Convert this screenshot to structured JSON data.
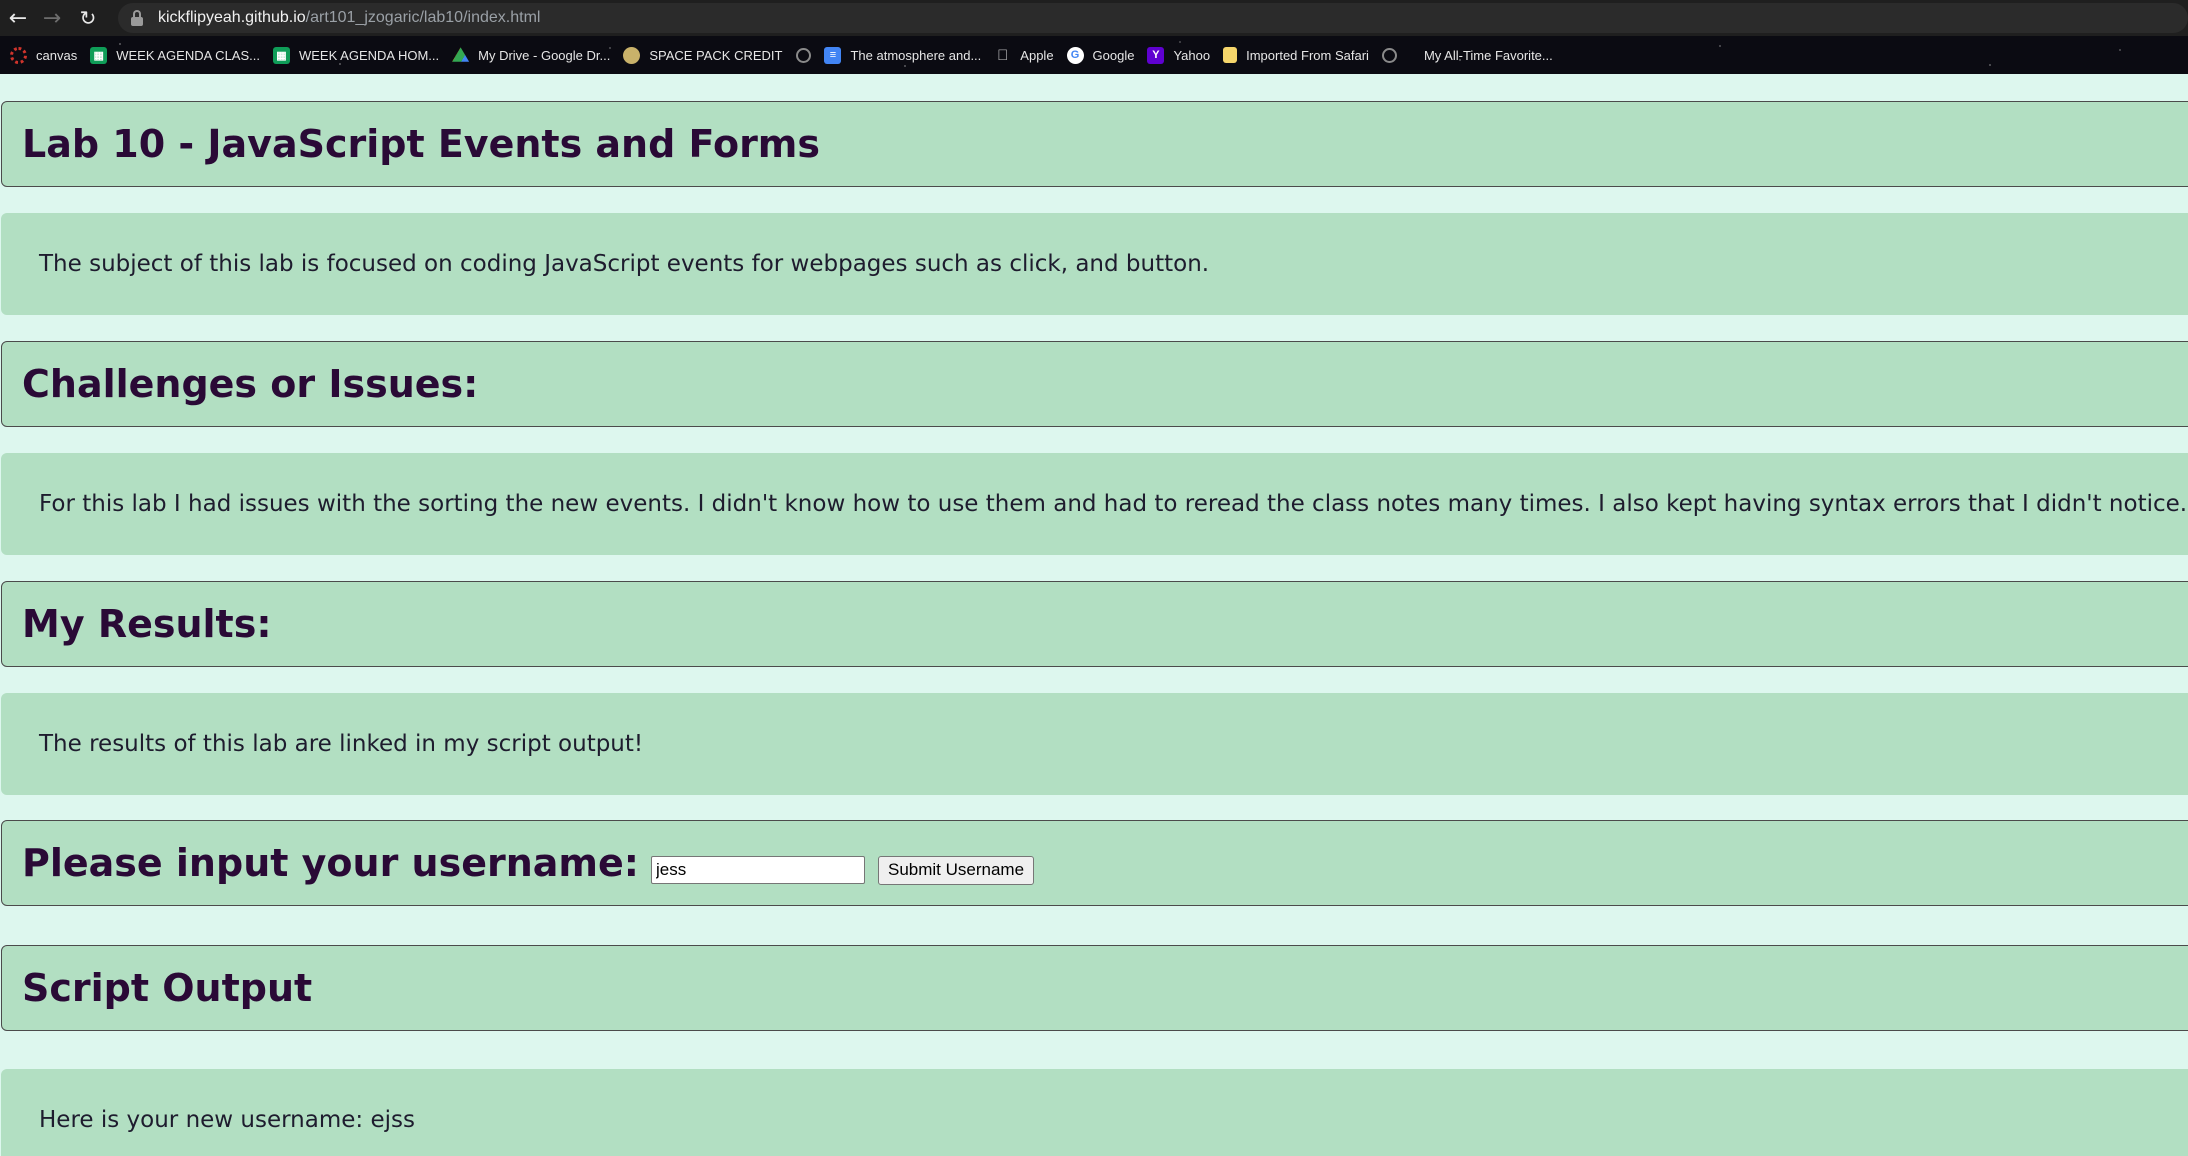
{
  "browser": {
    "url_host": "kickflipyeah.github.io",
    "url_path": "/art101_jzogaric/lab10/index.html",
    "bookmarks": [
      {
        "label": "canvas",
        "icon": "canvas-icon"
      },
      {
        "label": "WEEK AGENDA CLAS...",
        "icon": "sheets-icon"
      },
      {
        "label": "WEEK AGENDA HOM...",
        "icon": "sheets-icon"
      },
      {
        "label": "My Drive - Google Dr...",
        "icon": "drive-icon"
      },
      {
        "label": "SPACE PACK CREDIT",
        "icon": "space-pack-icon"
      },
      {
        "label": "The atmosphere and...",
        "icon": "docs-icon"
      },
      {
        "label": "Apple",
        "icon": "apple-icon"
      },
      {
        "label": "Google",
        "icon": "google-icon"
      },
      {
        "label": "Yahoo",
        "icon": "yahoo-icon"
      },
      {
        "label": "Imported From Safari",
        "icon": "folder-icon"
      },
      {
        "label": "My All-Time Favorite...",
        "icon": "globe-icon"
      }
    ]
  },
  "page": {
    "title": "Lab 10 - JavaScript Events and Forms",
    "intro": "The subject of this lab is focused on coding JavaScript events for webpages such as click, and button.",
    "challenges_heading": "Challenges or Issues:",
    "challenges_text": "For this lab I had issues with the sorting the new events. I didn't know how to use them and had to reread the class notes many times. I also kept having syntax errors that I didn't notice.",
    "results_heading": "My Results:",
    "results_text": "The results of this lab are linked in my script output!",
    "form": {
      "prompt": "Please input your username:",
      "input_value": "jess",
      "submit_label": "Submit Username"
    },
    "output_heading": "Script Output",
    "output_text": "Here is your new username: ejss"
  },
  "colors": {
    "page_background": "#ddf7ee",
    "box_background": "#b2dfc2",
    "heading_text": "#2a0a36"
  }
}
